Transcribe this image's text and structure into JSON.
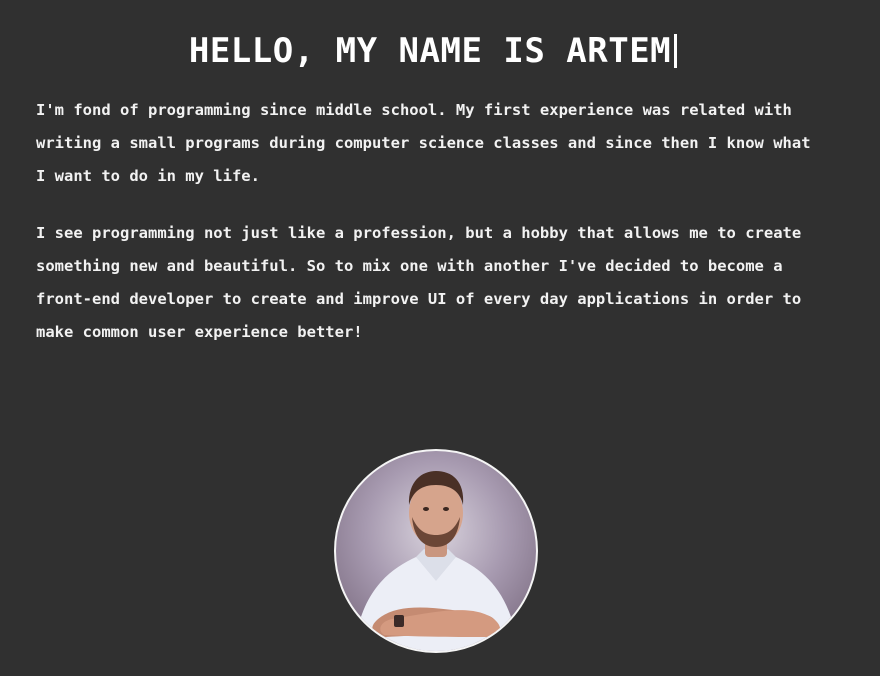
{
  "header": {
    "title": "HELLO, MY NAME IS ARTEM"
  },
  "about": {
    "paragraph1": [
      "I'm fond of programming since middle school. My first experience was related with",
      "writing a small programs during computer science classes and since then I know what",
      "I want to do in my life."
    ],
    "paragraph2": [
      "I see programming not just like a profession, but a hobby that allows me to create",
      "something new and beautiful. So to mix one with another I've decided to become a",
      "front-end developer to create and improve UI of every day applications in order to",
      "make common user experience better!"
    ]
  },
  "colors": {
    "background": "#303030",
    "text": "#f2f2f2",
    "avatar_border": "#f5f5f5"
  }
}
